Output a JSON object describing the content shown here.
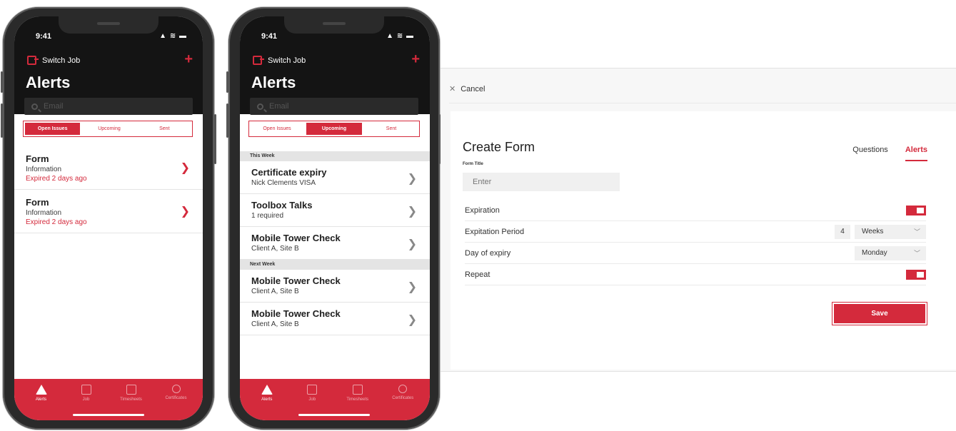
{
  "status_bar": {
    "time": "9:41",
    "icons": "▲ ≋ ▬"
  },
  "phone1": {
    "switch_job": "Switch Job",
    "title": "Alerts",
    "search_placeholder": "Email",
    "segments": [
      "Open Issues",
      "Upcoming",
      "Sent"
    ],
    "active_segment": 0,
    "items": [
      {
        "title": "Form",
        "subtitle": "Information",
        "status": "Expired 2 days ago"
      },
      {
        "title": "Form",
        "subtitle": "Information",
        "status": "Expired 2 days ago"
      }
    ]
  },
  "phone2": {
    "switch_job": "Switch Job",
    "title": "Alerts",
    "search_placeholder": "Email",
    "segments": [
      "Open Issues",
      "Upcoming",
      "Sent"
    ],
    "active_segment": 1,
    "sections": [
      {
        "header": "This Week",
        "items": [
          {
            "title": "Certificate expiry",
            "subtitle": "Nick Clements VISA"
          },
          {
            "title": "Toolbox Talks",
            "subtitle": "1 required"
          },
          {
            "title": "Mobile Tower Check",
            "subtitle": "Client A, Site B"
          }
        ]
      },
      {
        "header": "Next Week",
        "items": [
          {
            "title": "Mobile Tower Check",
            "subtitle": "Client A, Site B"
          },
          {
            "title": "Mobile Tower Check",
            "subtitle": "Client A, Site B"
          }
        ]
      }
    ]
  },
  "tabbar": {
    "items": [
      {
        "label": "Alerts",
        "icon": "alert-triangle-icon"
      },
      {
        "label": "Job",
        "icon": "document-icon"
      },
      {
        "label": "Timesheets",
        "icon": "clock-icon"
      },
      {
        "label": "Certificates",
        "icon": "badge-icon"
      }
    ],
    "active": 0
  },
  "form": {
    "cancel_label": "Cancel",
    "title": "Create Form",
    "tabs": [
      "Questions",
      "Alerts"
    ],
    "active_tab": 1,
    "field_label": "Form Title",
    "field_placeholder": "Enter",
    "rows": {
      "expiration": "Expiration",
      "expiration_period": "Expitation Period",
      "period_number": "4",
      "period_unit": "Weeks",
      "day_of_expiry": "Day of expiry",
      "day_value": "Monday",
      "repeat": "Repeat"
    },
    "save_label": "Save"
  },
  "colors": {
    "brand": "#d42a3c",
    "dark": "#141414"
  }
}
